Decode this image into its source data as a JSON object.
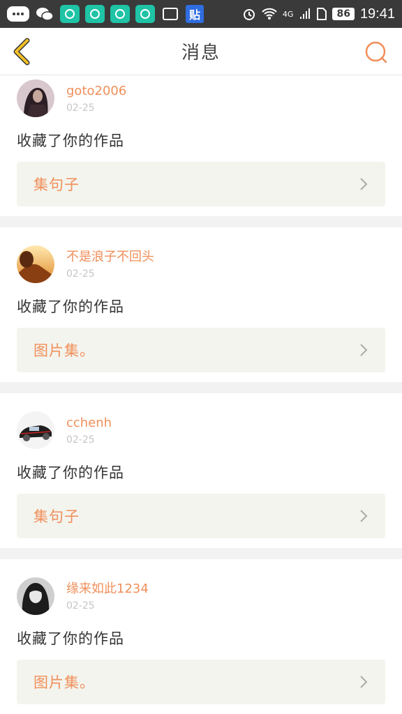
{
  "status_bar": {
    "network": "4G",
    "battery": "86",
    "time": "19:41",
    "tie_label": "贴"
  },
  "header": {
    "title": "消息"
  },
  "colors": {
    "accent": "#f08f5a",
    "date": "#c5c5c5",
    "card_link_bg": "#f4f4ee",
    "back_arrow": "#f3c026"
  },
  "messages": [
    {
      "user": "goto2006",
      "date": "02-25",
      "action": "收藏了你的作品",
      "work": "集句子",
      "avatar": "avatar-dark-hair-icon"
    },
    {
      "user": "不是浪子不回头",
      "date": "02-25",
      "action": "收藏了你的作品",
      "work": "图片集。",
      "avatar": "avatar-sunset-icon"
    },
    {
      "user": "cchenh",
      "date": "02-25",
      "action": "收藏了你的作品",
      "work": "集句子",
      "avatar": "avatar-car-icon"
    },
    {
      "user": "缘来如此1234",
      "date": "02-25",
      "action": "收藏了你的作品",
      "work": "图片集。",
      "avatar": "avatar-bw-portrait-icon"
    }
  ]
}
